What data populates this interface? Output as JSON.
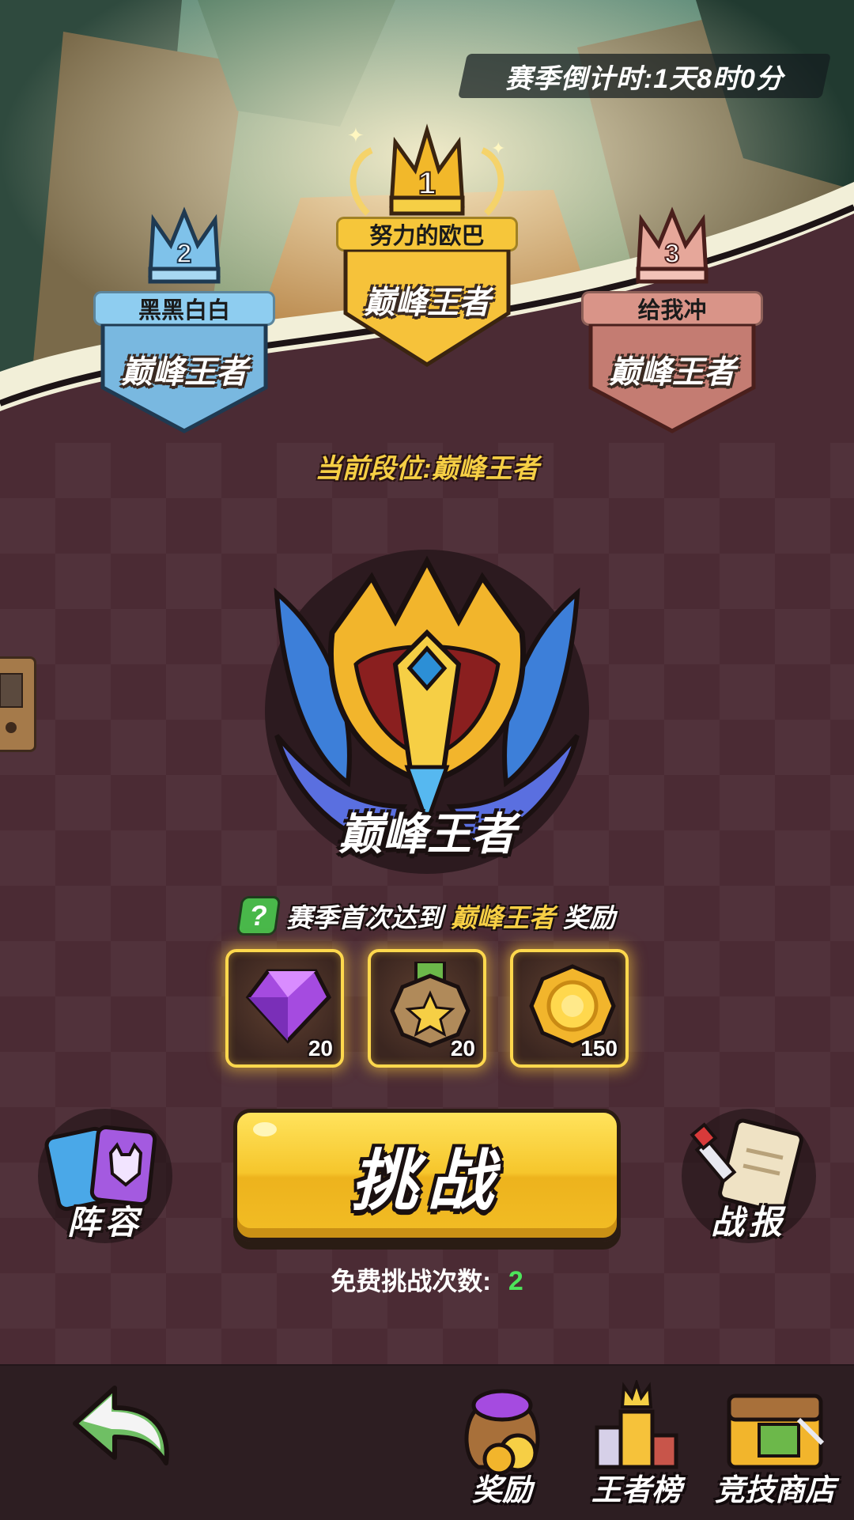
{
  "header": {
    "season_countdown": "赛季倒计时:1天8时0分"
  },
  "podium": {
    "first": {
      "rank": "1",
      "name": "努力的欧巴",
      "tier": "巅峰王者"
    },
    "second": {
      "rank": "2",
      "name": "黑黑白白",
      "tier": "巅峰王者"
    },
    "third": {
      "rank": "3",
      "name": "给我冲",
      "tier": "巅峰王者"
    }
  },
  "current_rank": {
    "text": "当前段位:巅峰王者"
  },
  "emblem": {
    "title": "巅峰王者",
    "icon": "peak-king-emblem-icon"
  },
  "season_reward": {
    "help_icon": "?",
    "prefix": "赛季首次达到",
    "highlight": "巅峰王者",
    "suffix": "奖励",
    "items": [
      {
        "icon": "purple-gem-icon",
        "count": "20"
      },
      {
        "icon": "star-medal-icon",
        "count": "20"
      },
      {
        "icon": "gold-coin-icon",
        "count": "150"
      }
    ]
  },
  "actions": {
    "lineup_label": "阵容",
    "challenge_label": "挑战",
    "battle_report_label": "战报",
    "free_challenges_label": "免费挑战次数:",
    "free_challenges_count": "2"
  },
  "bottom_nav": {
    "back_icon": "back-arrow-icon",
    "items": [
      {
        "label": "奖励",
        "icon": "rewards-bag-icon"
      },
      {
        "label": "王者榜",
        "icon": "leaderboard-icon"
      },
      {
        "label": "竞技商店",
        "icon": "arena-shop-icon"
      }
    ]
  },
  "colors": {
    "gold": "#f6cf45",
    "blue_rank": "#7fc2ea",
    "red_rank": "#c98278",
    "green_count": "#4de35a",
    "background": "#4b2b34"
  }
}
